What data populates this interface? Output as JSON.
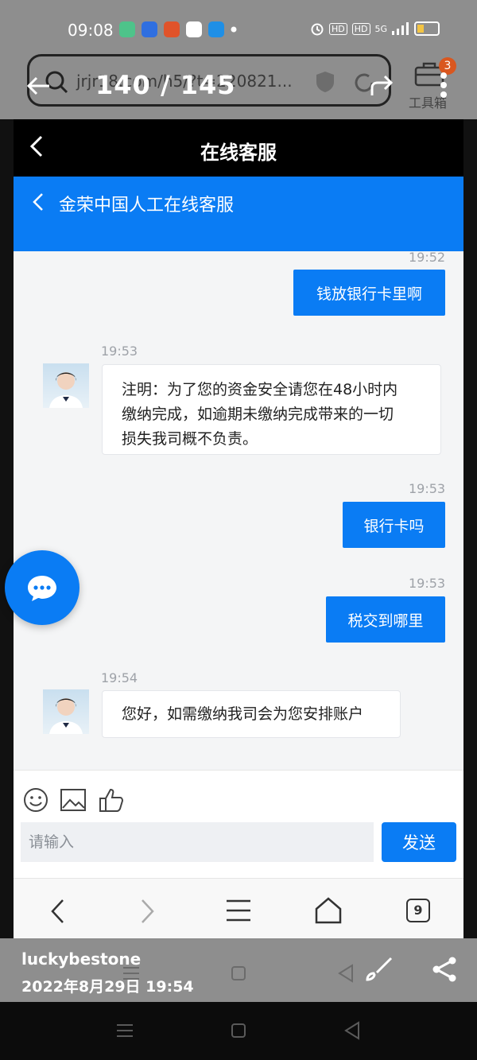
{
  "status_bar": {
    "time": "09:08",
    "app_icon_colors": [
      "#4ec38a",
      "#2f6fe0",
      "#e0532a",
      "#ffffff",
      "#1f8fe6"
    ],
    "network_label": "5G"
  },
  "viewer": {
    "counter": "140 / 145",
    "url_text": "jrjr18.com/h5/?t=220821...",
    "toolbox_label": "工具箱",
    "toolbox_badge": "3"
  },
  "app": {
    "title": "在线客服",
    "header_title": "金荣中国人工在线客服"
  },
  "chat": {
    "messages": [
      {
        "side": "out",
        "time": "19:52",
        "text": "钱放银行卡里啊"
      },
      {
        "side": "in",
        "time": "19:53",
        "lines": [
          "注明：为了您的资金安全请您在48小时内",
          "缴纳完成，如逾期未缴纳完成带来的一切",
          "损失我司概不负责。"
        ]
      },
      {
        "side": "out",
        "time": "19:53",
        "text": "银行卡吗"
      },
      {
        "side": "out",
        "time": "19:53",
        "text": "税交到哪里"
      },
      {
        "side": "in",
        "time": "19:54",
        "text": "您好，如需缴纳我司会为您安排账户"
      }
    ]
  },
  "composer": {
    "placeholder": "请输入",
    "send_label": "发送"
  },
  "browser_nav": {
    "tab_count": "9"
  },
  "caption": {
    "user": "luckybestone",
    "date": "2022年8月29日 19:54"
  },
  "colors": {
    "accent": "#0a7cf4",
    "chat_bg": "#f4f5f6",
    "timestamp": "#9ea2a8"
  }
}
